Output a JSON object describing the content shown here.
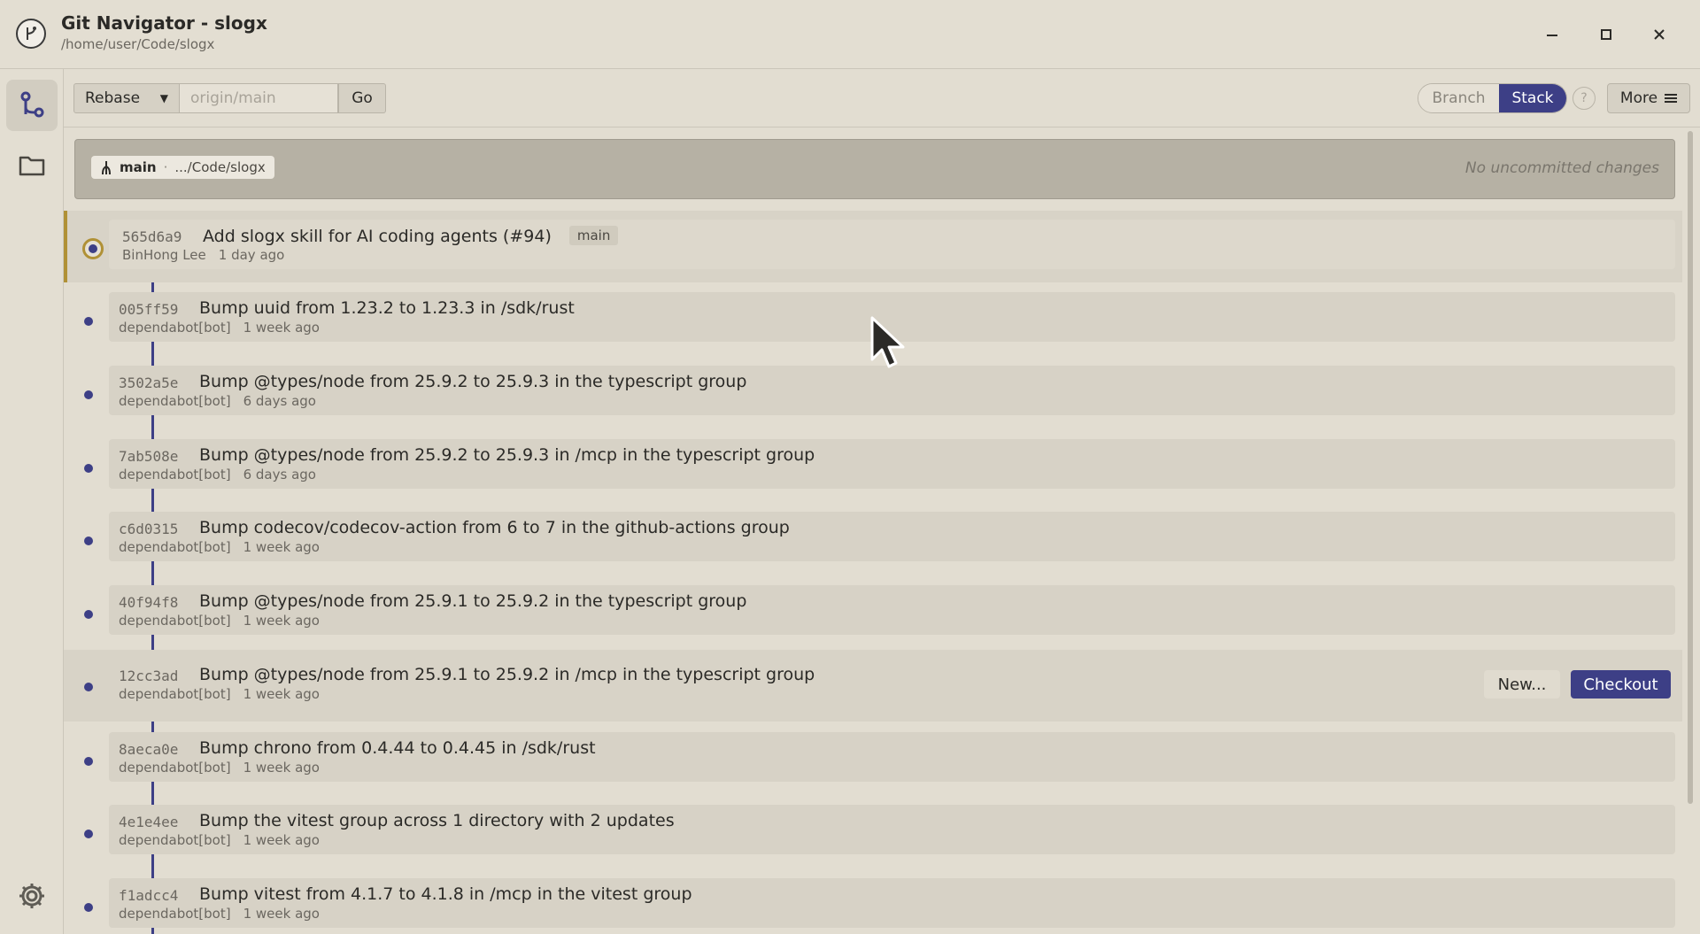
{
  "window": {
    "title": "Git Navigator - slogx",
    "subtitle": "/home/user/Code/slogx",
    "minimize_icon": "minimize-icon",
    "maximize_icon": "maximize-icon",
    "close_icon": "close-icon"
  },
  "rail": {
    "items": [
      {
        "icon": "git-graph-icon",
        "active": true
      },
      {
        "icon": "folder-icon",
        "active": false
      }
    ],
    "settings_icon": "gear-icon"
  },
  "toolbar": {
    "action_select": "Rebase",
    "ref_placeholder": "origin/main",
    "go_label": "Go",
    "view_options": [
      "Branch",
      "Stack"
    ],
    "view_selected": "Stack",
    "help_label": "?",
    "more_label": "More"
  },
  "status": {
    "branch": "main",
    "separator": "·",
    "path": ".../Code/slogx",
    "changes": "No uncommitted changes"
  },
  "commits": [
    {
      "hash": "565d6a9",
      "message": "Add slogx skill for AI coding agents (#94)",
      "author": "BinHong Lee",
      "date": "1 day ago",
      "tag": "main",
      "head": true
    },
    {
      "hash": "005ff59",
      "message": "Bump uuid from 1.23.2 to 1.23.3 in /sdk/rust",
      "author": "dependabot[bot]",
      "date": "1 week ago"
    },
    {
      "hash": "3502a5e",
      "message": "Bump @types/node from 25.9.2 to 25.9.3 in the typescript group",
      "author": "dependabot[bot]",
      "date": "6 days ago"
    },
    {
      "hash": "7ab508e",
      "message": "Bump @types/node from 25.9.2 to 25.9.3 in /mcp in the typescript group",
      "author": "dependabot[bot]",
      "date": "6 days ago"
    },
    {
      "hash": "c6d0315",
      "message": "Bump codecov/codecov-action from 6 to 7 in the github-actions group",
      "author": "dependabot[bot]",
      "date": "1 week ago"
    },
    {
      "hash": "40f94f8",
      "message": "Bump @types/node from 25.9.1 to 25.9.2 in the typescript group",
      "author": "dependabot[bot]",
      "date": "1 week ago"
    },
    {
      "hash": "12cc3ad",
      "message": "Bump @types/node from 25.9.1 to 25.9.2 in /mcp in the typescript group",
      "author": "dependabot[bot]",
      "date": "1 week ago",
      "hover": true
    },
    {
      "hash": "8aeca0e",
      "message": "Bump chrono from 0.4.44 to 0.4.45 in /sdk/rust",
      "author": "dependabot[bot]",
      "date": "1 week ago"
    },
    {
      "hash": "4e1e4ee",
      "message": "Bump the vitest group across 1 directory with 2 updates",
      "author": "dependabot[bot]",
      "date": "1 week ago"
    },
    {
      "hash": "f1adcc4",
      "message": "Bump vitest from 4.1.7 to 4.1.8 in /mcp in the vitest group",
      "author": "dependabot[bot]",
      "date": "1 week ago"
    }
  ],
  "row_actions": {
    "new_label": "New...",
    "checkout_label": "Checkout"
  },
  "colors": {
    "accent": "#3d3f86",
    "head_marker": "#b09136",
    "background": "#e2ddd1"
  }
}
